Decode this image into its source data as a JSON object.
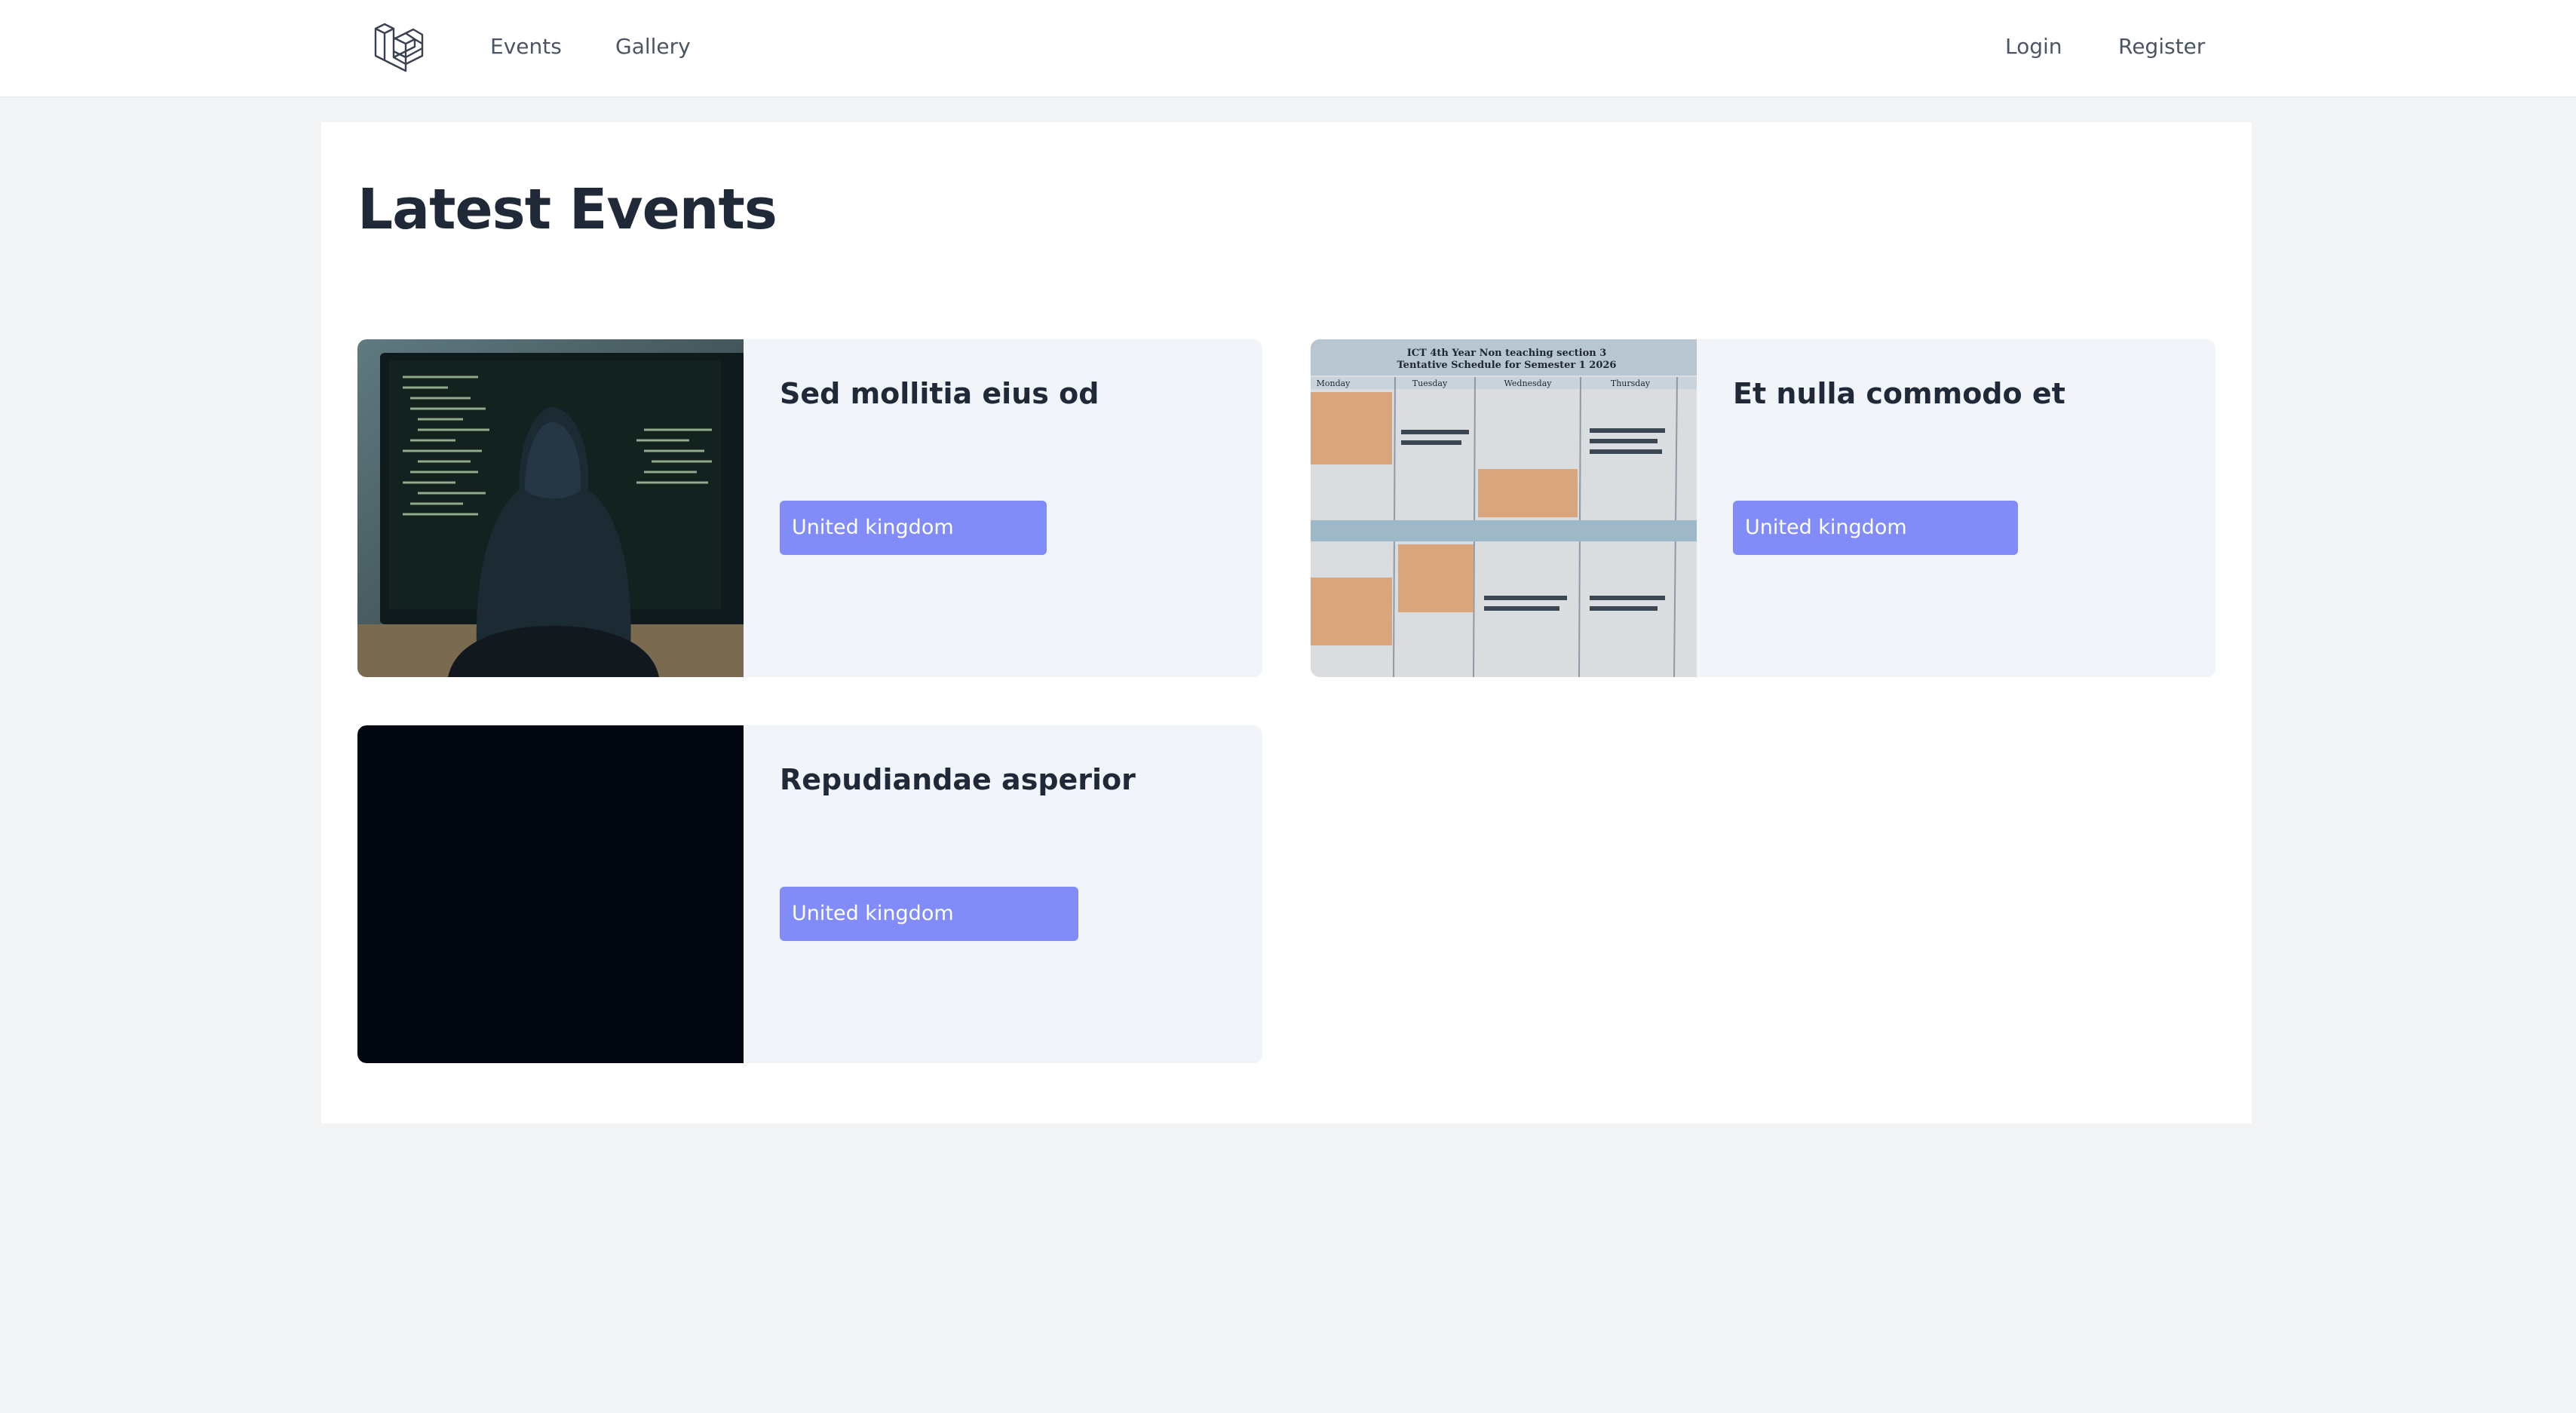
{
  "nav": {
    "logo_icon": "laravel-logo-icon",
    "links": [
      {
        "label": "Events"
      },
      {
        "label": "Gallery"
      }
    ],
    "auth": {
      "login": "Login",
      "register": "Register"
    }
  },
  "main": {
    "title": "Latest Events",
    "events": [
      {
        "title": "Sed mollitia eius od",
        "location": "United kingdom",
        "image": "hooded-person-at-computer-image"
      },
      {
        "title": "Et nulla commodo et",
        "location": "United kingdom",
        "image": "class-schedule-photo-image",
        "image_text": {
          "heading_1": "ICT 4th Year Non teaching section 3",
          "heading_2": "Tentative Schedule for Semester 1 2026",
          "days": [
            "Monday",
            "Tuesday",
            "Wednesday",
            "Thursday"
          ]
        }
      },
      {
        "title": "Repudiandae asperior",
        "location": "United kingdom",
        "image": "dark-placeholder-image"
      }
    ]
  },
  "colors": {
    "page_bg": "#f3f4f6",
    "card_bg": "#f1f5f9",
    "badge_bg": "#818cf8",
    "text_dark": "#1f2937",
    "nav_text": "#4b5563"
  }
}
